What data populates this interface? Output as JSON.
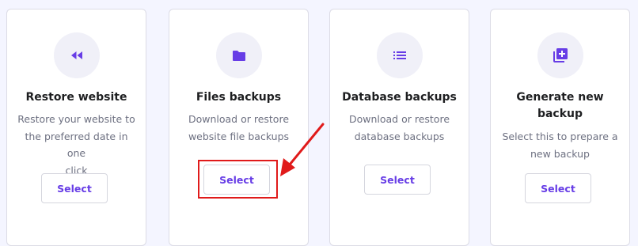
{
  "accent_color": "#673de6",
  "annotation_color": "#e01a1a",
  "cards": [
    {
      "icon": "rewind-icon",
      "title": "Restore website",
      "description": [
        "Restore your website to",
        "the preferred date in one",
        "click"
      ],
      "button_label": "Select"
    },
    {
      "icon": "folder-icon",
      "title": "Files backups",
      "description": [
        "Download or restore",
        "website file backups"
      ],
      "button_label": "Select"
    },
    {
      "icon": "list-icon",
      "title": "Database backups",
      "description": [
        "Download or restore",
        "database backups"
      ],
      "button_label": "Select"
    },
    {
      "icon": "add-library-icon",
      "title": [
        "Generate new",
        "backup"
      ],
      "description": [
        "Select this to prepare a",
        "new backup"
      ],
      "button_label": "Select"
    }
  ]
}
